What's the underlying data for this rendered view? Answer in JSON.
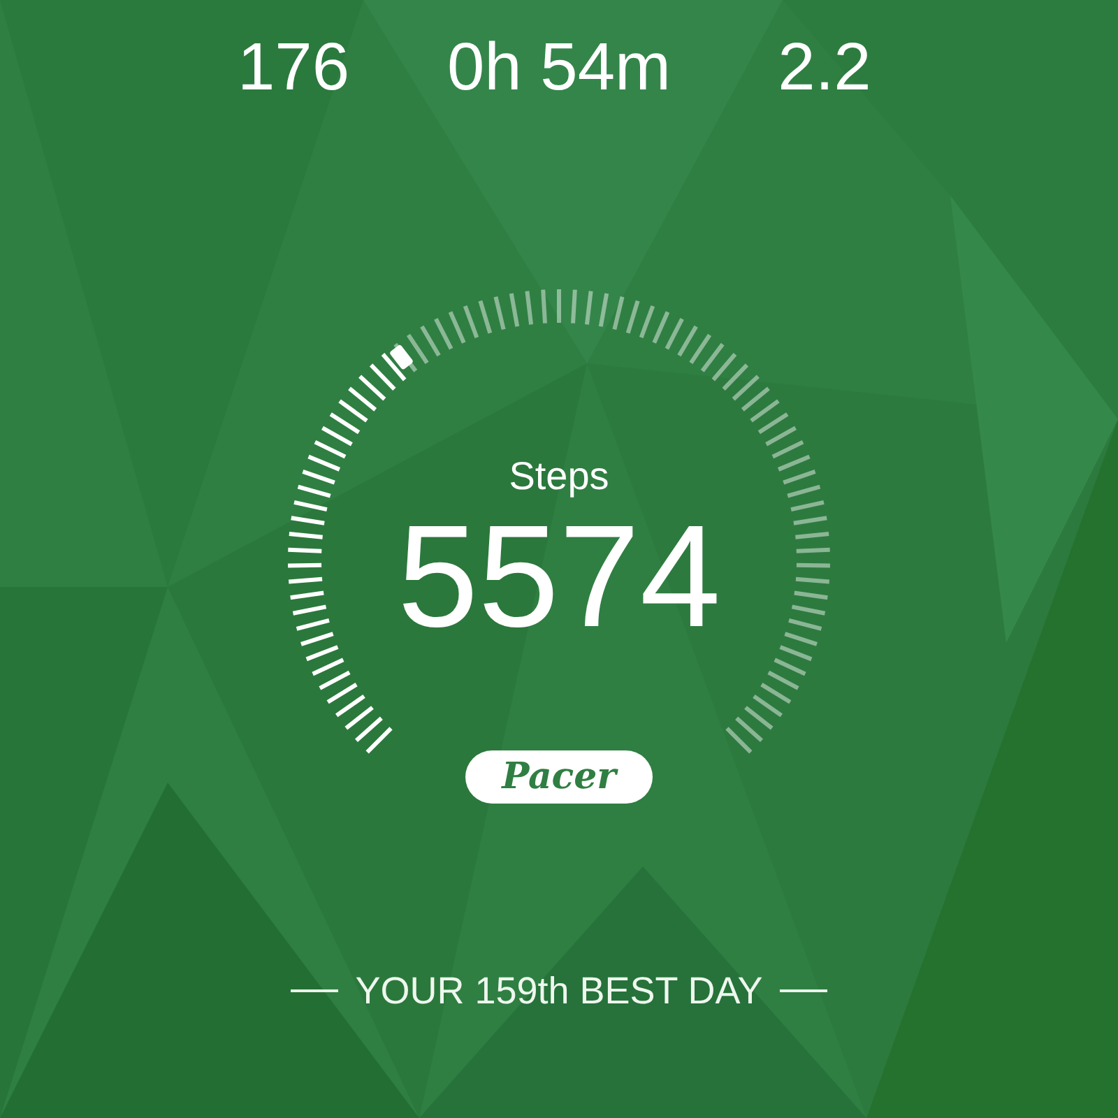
{
  "stats": [
    {
      "value": "176"
    },
    {
      "value": "0h 54m"
    },
    {
      "value": "2.2"
    }
  ],
  "steps": {
    "label": "Steps",
    "value": "5574"
  },
  "badge": {
    "label": "Pacer"
  },
  "rank": {
    "text": "YOUR 159th BEST DAY"
  }
}
